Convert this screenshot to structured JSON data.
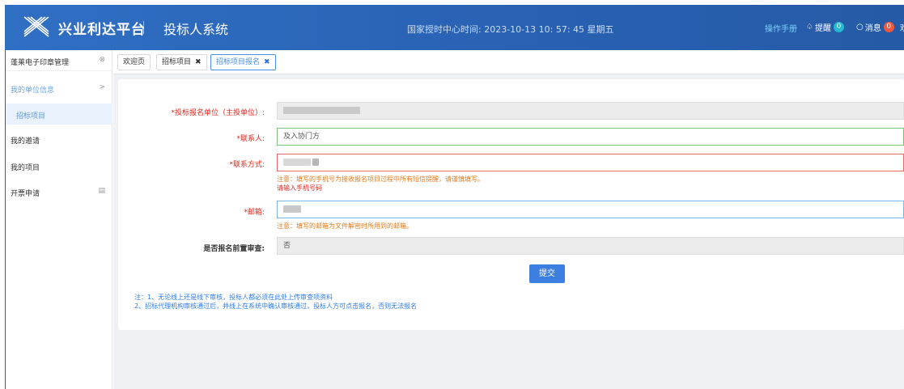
{
  "header": {
    "logo_text": "兴业利达平台",
    "system_name": "投标人系统",
    "time_label": "国家授时中心时间: 2023-10-13 10: 57: 45 星期五",
    "manual": "操作手册",
    "reminder_label": "提醒",
    "reminder_count": "0",
    "message_label": "消息",
    "message_count": "0",
    "welcome": "欢"
  },
  "sidebar": {
    "top_item": "蓬莱电子印章管理",
    "items": [
      {
        "label": "我的单位信息",
        "suffix": ">"
      },
      {
        "label": "招标项目"
      },
      {
        "label": "我的邀请"
      },
      {
        "label": "我的项目"
      },
      {
        "label": "开票申请"
      }
    ]
  },
  "tabs": [
    {
      "label": "欢迎页"
    },
    {
      "label": "招标项目",
      "close": "✖"
    },
    {
      "label": "招标项目报名",
      "close": "✖"
    }
  ],
  "form": {
    "fields": [
      {
        "label": "*投标报名单位（主投单位）:",
        "value": ""
      },
      {
        "label": "*联系人:",
        "value": "及入协门方"
      },
      {
        "label": "*联系方式:",
        "value": ""
      },
      {
        "label": "*邮箱:",
        "value": ""
      },
      {
        "label": "是否报名前置审查:",
        "value": "否"
      }
    ],
    "phone_note": "注意：填写的手机号为接收报名项目过程中所有短信提醒，请谨慎填写。",
    "phone_error": "请输入手机号码",
    "email_note": "注意：填写的邮箱为文件解密时所用到的邮箱。",
    "submit_label": "提交",
    "footnotes": [
      "注：1、无论线上还是线下审核，投标人都必须在此处上传审查项资料",
      "2、招标代理机构审核通过后，并线上在系统中确认审核通过，投标人方可点击报名，否则无法报名"
    ]
  }
}
